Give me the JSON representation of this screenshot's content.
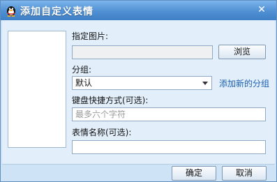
{
  "window": {
    "title": "添加自定义表情",
    "title_icon": "qq-penguin-icon",
    "close_glyph": "✕",
    "close_icon": "close-icon"
  },
  "form": {
    "image_label": "指定图片:",
    "image_path_value": "",
    "browse_label": "浏览",
    "group_label": "分组:",
    "group_selected": "默认",
    "add_group_link": "添加新的分组",
    "shortcut_label": "键盘快捷方式(可选):",
    "shortcut_placeholder": "最多六个字符",
    "shortcut_value": "",
    "name_label": "表情名称(可选):",
    "name_value": ""
  },
  "footer": {
    "ok_label": "确定",
    "cancel_label": "取消"
  },
  "colors": {
    "titlebar": "#4f8fd2",
    "content_bg": "#e2effb",
    "link": "#1a5fb0"
  }
}
